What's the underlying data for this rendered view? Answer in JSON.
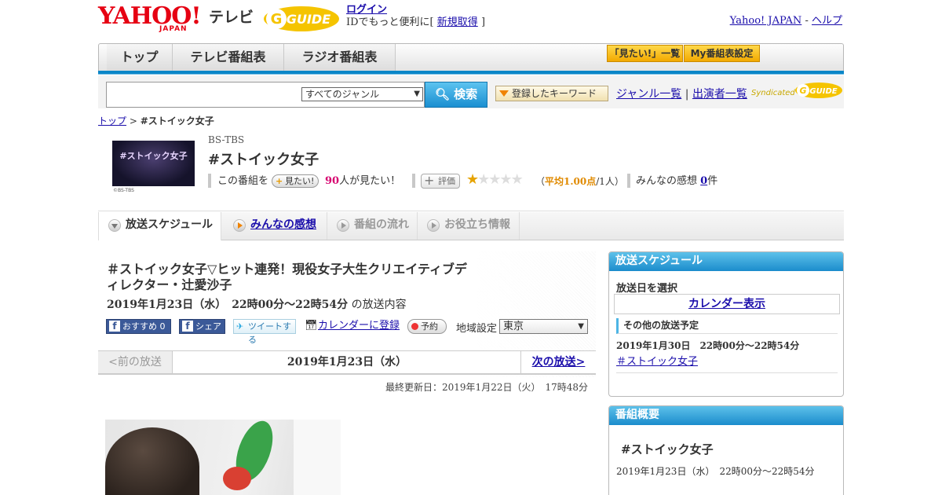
{
  "header": {
    "yahoo_logo": "YAHOO!",
    "yahoo_logo_sub": "JAPAN",
    "tv_label": "テレビ",
    "guide_logo": "GUIDE",
    "login_link": "ログイン",
    "login_text_pre": "IDでもっと便利に[",
    "signup_link": "新規取得",
    "login_text_post": "]",
    "yahoo_japan_link": "Yahoo! JAPAN",
    "help_sep": "-",
    "help_link": "ヘルプ"
  },
  "nav": {
    "tabs": [
      "トップ",
      "テレビ番組表",
      "ラジオ番組表"
    ],
    "mitai_list": "「見たい!」一覧",
    "my_bangumi": "My番組表設定"
  },
  "search": {
    "genre_selected": "すべてのジャンル",
    "button": "検索",
    "keyword_button": "登録したキーワード",
    "genre_list": "ジャンル一覧",
    "separator": "|",
    "performer_list": "出演者一覧",
    "syndicated": "Syndicated"
  },
  "breadcrumb": {
    "top": "トップ",
    "sep": ">",
    "current": "#ストイック女子"
  },
  "program": {
    "thumb_text": "#ストイック女子",
    "thumb_caption": "©BS-TBS",
    "channel": "BS-TBS",
    "title": "#ストイック女子",
    "mitai_pre": "この番組を",
    "mitai_button": "見たい!",
    "mitai_count": "90",
    "mitai_post": "人が見たい！",
    "hyoka_button": "評価",
    "rating": 1,
    "rating_max": 5,
    "rating_text_pre": "（",
    "rating_avg": "平均1.00点",
    "rating_text_post": "/1人）",
    "kanso_label": "みんなの感想",
    "kanso_count": "0",
    "kanso_unit": "件"
  },
  "tabs": [
    {
      "label": "放送スケジュール"
    },
    {
      "label": "みんなの感想"
    },
    {
      "label": "番組の流れ"
    },
    {
      "label": "お役立ち情報"
    }
  ],
  "episode": {
    "title": "＃ストイック女子▽ヒット連発！現役女子大生クリエイティブディレクター・辻愛沙子",
    "date": "2019年1月23日（水）　22時00分～22時54分",
    "date_suffix": "の放送内容",
    "fb_recommend": "おすすめ 0",
    "fb_share": "シェア",
    "tweet": "ツイートする",
    "calendar": "カレンダーに登録",
    "reserve": "予約",
    "region_label": "地域設定",
    "region": "東京",
    "prev": "<前の放送",
    "current_date": "2019年1月23日（水）",
    "next": "次の放送>",
    "updated": "最終更新日：2019年1月22日（火）　17時48分"
  },
  "sidebar": {
    "schedule_header": "放送スケジュール",
    "select_date": "放送日を選択",
    "calendar_button": "カレンダー表示",
    "other_label": "その他の放送予定",
    "other_date": "2019年1月30日　22時00分～22時54分",
    "other_title": "＃ストイック女子",
    "overview_header": "番組概要",
    "overview_title": "#ストイック女子",
    "overview_date": "2019年1月23日（水）　22時00分～22時54分"
  },
  "colors": {
    "accent_blue": "#0a86c8",
    "yahoo_red": "#e60012",
    "link": "#1a0dab",
    "star": "#e6a300"
  }
}
